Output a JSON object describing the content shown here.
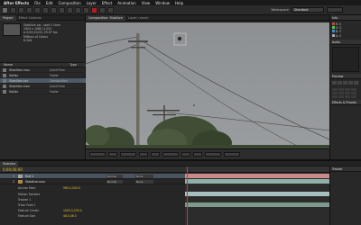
{
  "menubar": {
    "app": "After Effects",
    "items": [
      "File",
      "Edit",
      "Composition",
      "Layer",
      "Effect",
      "Animation",
      "View",
      "Window",
      "Help"
    ]
  },
  "toolbar": {
    "workspace_label": "Workspace",
    "workspace_value": "Standard"
  },
  "project": {
    "tabs": [
      "Project",
      "Effect Controls"
    ],
    "meta": [
      "Stabilize-car, used 1 time",
      "1920 x 1080 (1.00)",
      "Δ 0;00;10;00, 29.97 fps",
      "Millions of Colors",
      "H.264"
    ],
    "header": "Name",
    "type_header": "Type",
    "items": [
      {
        "name": "Stabilize.mov",
        "type": "QuickTime"
      },
      {
        "name": "Solids",
        "type": "Folder"
      },
      {
        "name": "Stabilize-car",
        "type": "Composition"
      },
      {
        "name": "Stabilize.mov",
        "type": "QuickTime"
      },
      {
        "name": "Solids",
        "type": "Folder"
      }
    ]
  },
  "viewer": {
    "tabs": [
      "Composition: Stabilize",
      "Layer: (none)"
    ],
    "active_tab": "Stabilize"
  },
  "right_panel": {
    "info_title": "Info",
    "info_lines": [
      "R: 0",
      "G: 0",
      "B: 0",
      "A: 0"
    ],
    "audio_title": "Audio",
    "preview_title": "Preview",
    "effects_title": "Effects & Presets",
    "tracker_title": "Tracker"
  },
  "timeline": {
    "tab": "Stabilize",
    "timecode": "0;00;00;00",
    "layers": [
      {
        "num": "1",
        "name": "Null 1",
        "mode": "Normal",
        "parent": "None",
        "color": "#a3a3a3"
      },
      {
        "num": "2",
        "name": "Stabilize.mov",
        "mode": "Normal",
        "parent": "None",
        "color": "#b08a4a"
      }
    ],
    "props": [
      {
        "name": "Anchor Point",
        "value": "960.0,540.0"
      },
      {
        "name": "Motion Trackers",
        "value": ""
      },
      {
        "name": "Tracker 1",
        "value": ""
      },
      {
        "name": "Track Point 1",
        "value": ""
      },
      {
        "name": "Feature Center",
        "value": "1005.0,250.0"
      },
      {
        "name": "Feature Size",
        "value": "46.0,46.0"
      }
    ],
    "track_colors": [
      "#c98a8a",
      "#8fb0a8",
      "#a8bfbf",
      "#7e9a8e"
    ]
  }
}
